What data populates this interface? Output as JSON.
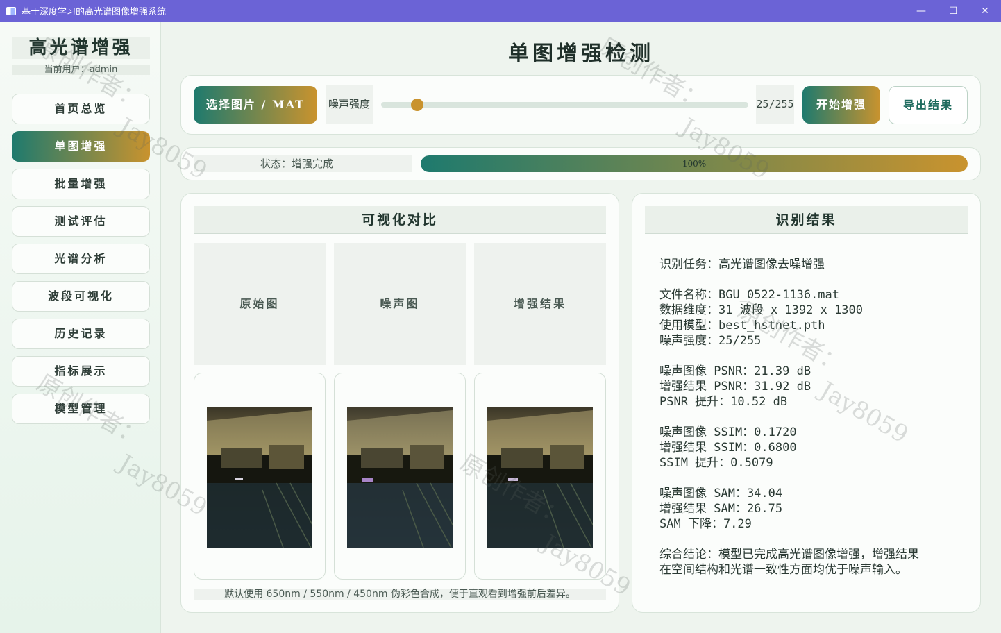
{
  "window": {
    "title": "基于深度学习的高光谱图像增强系统",
    "minimize": "—",
    "maximize": "☐",
    "close": "✕"
  },
  "sidebar": {
    "brand": "高光谱增强",
    "current_user": "当前用户：admin",
    "items": [
      {
        "label": "首页总览"
      },
      {
        "label": "单图增强"
      },
      {
        "label": "批量增强"
      },
      {
        "label": "测试评估"
      },
      {
        "label": "光谱分析"
      },
      {
        "label": "波段可视化"
      },
      {
        "label": "历史记录"
      },
      {
        "label": "指标展示"
      },
      {
        "label": "模型管理"
      }
    ],
    "active_index": 1
  },
  "page_title": "单图增强检测",
  "toolbar": {
    "select_button": "选择图片 / MAT",
    "noise_label": "噪声强度",
    "noise_value_text": "25/255",
    "noise_value": 25,
    "noise_max": 255,
    "start_button": "开始增强",
    "export_button": "导出结果"
  },
  "status": {
    "text": "状态：增强完成",
    "progress": 100,
    "progress_label": "100%"
  },
  "visual": {
    "title": "可视化对比",
    "labels": [
      "原始图",
      "噪声图",
      "增强结果"
    ],
    "caption": "默认使用 650nm / 550nm / 450nm 伪彩色合成，便于直观看到增强前后差异。"
  },
  "results": {
    "title": "识别结果",
    "text": "识别任务：高光谱图像去噪增强\n\n文件名称：BGU_0522-1136.mat\n数据维度：31 波段 x 1392 x 1300\n使用模型：best_hstnet.pth\n噪声强度：25/255\n\n噪声图像 PSNR：21.39 dB\n增强结果 PSNR：31.92 dB\nPSNR 提升：10.52 dB\n\n噪声图像 SSIM：0.1720\n增强结果 SSIM：0.6800\nSSIM 提升：0.5079\n\n噪声图像 SAM：34.04\n增强结果 SAM：26.75\nSAM 下降：7.29\n\n综合结论：模型已完成高光谱图像增强，增强结果\n在空间结构和光谱一致性方面均优于噪声输入。"
  },
  "watermark": {
    "line1": "原创作者：",
    "line2": "Jay8059"
  },
  "colors": {
    "accent_start": "#1e7a6e",
    "accent_end": "#c9932e",
    "titlebar": "#6b63d6"
  }
}
